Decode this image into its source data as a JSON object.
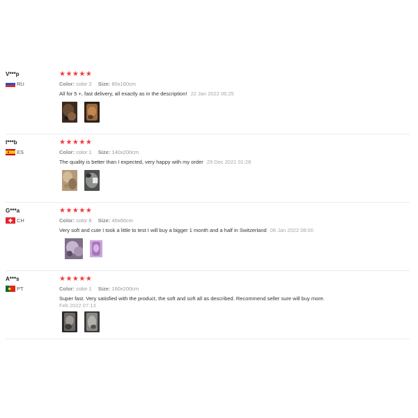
{
  "reviews": [
    {
      "user": "V***p",
      "country": "RU",
      "stars": "★★★★★",
      "color_label": "Color:",
      "color_value": "color 2",
      "size_label": "Size:",
      "size_value": "80x160cm",
      "text": "All for 5 +, fast delivery, all exactly as in the description!",
      "date": "22 Jan 2022 06:25",
      "photos": [
        "photo-brown-blanket",
        "photo-brown-blanket-folded"
      ]
    },
    {
      "user": "I***b",
      "country": "ES",
      "stars": "★★★★★",
      "color_label": "Color:",
      "color_value": "color 1",
      "size_label": "Size:",
      "size_value": "140x200cm",
      "text": "The quality is better than I expected, very happy with my order",
      "date": "29 Dec 2021 01:28",
      "photos": [
        "photo-beige-blanket",
        "photo-grey-blanket-label"
      ]
    },
    {
      "user": "G***a",
      "country": "CH",
      "stars": "★★★★★",
      "color_label": "Color:",
      "color_value": "color 6",
      "size_label": "Size:",
      "size_value": "40x60cm",
      "text": "Very soft and cute I took a little to test I will buy a bigger 1 month and a half in Switzerland",
      "date": "08 Jan 2022 08:00",
      "photos": [
        "photo-lilac-blanket",
        "photo-purple-blanket"
      ]
    },
    {
      "user": "A***s",
      "country": "PT",
      "stars": "★★★★★",
      "color_label": "Color:",
      "color_value": "color 1",
      "size_label": "Size:",
      "size_value": "160x200cm",
      "text": "Super fast. Very satisfied with the product, the soft and soft all as described. Recommend seller sure will buy more.",
      "date": "Feb 2022 07:13",
      "photos": [
        "photo-dark-grey-blanket",
        "photo-grey-blanket"
      ]
    }
  ],
  "colors": {
    "star": "#f5393c",
    "muted_text": "#999999",
    "divider": "#ececec"
  }
}
